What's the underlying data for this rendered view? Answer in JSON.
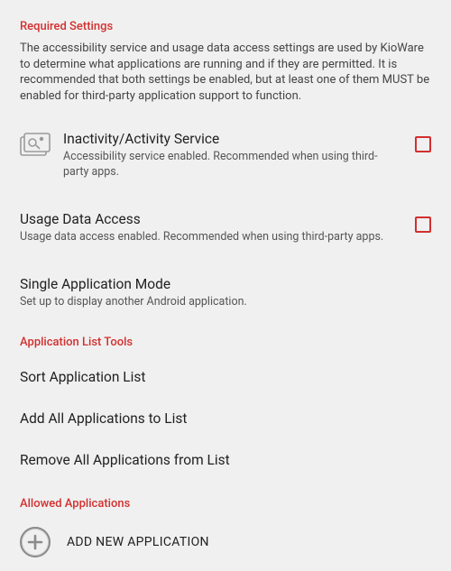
{
  "sections": {
    "required": {
      "header": "Required Settings",
      "description": "The accessibility service and usage data access settings are used by KioWare to determine what applications are running and if they are permitted. It is recommended that both settings be enabled, but at least one of them MUST be enabled for third-party application support to function."
    },
    "tools": {
      "header": "Application List Tools"
    },
    "allowed": {
      "header": "Allowed Applications"
    }
  },
  "items": {
    "inactivity": {
      "title": "Inactivity/Activity Service",
      "sub": "Accessibility service enabled. Recommended when using third-party apps.",
      "checked": false
    },
    "usage": {
      "title": "Usage Data Access",
      "sub": "Usage data access enabled. Recommended when using third-party apps.",
      "checked": false
    },
    "single": {
      "title": "Single Application Mode",
      "sub": "Set up to display another Android application."
    },
    "sort": {
      "title": "Sort Application List"
    },
    "addAll": {
      "title": "Add All Applications to List"
    },
    "removeAll": {
      "title": "Remove All Applications from List"
    },
    "addNew": {
      "label": "ADD NEW APPLICATION"
    }
  }
}
